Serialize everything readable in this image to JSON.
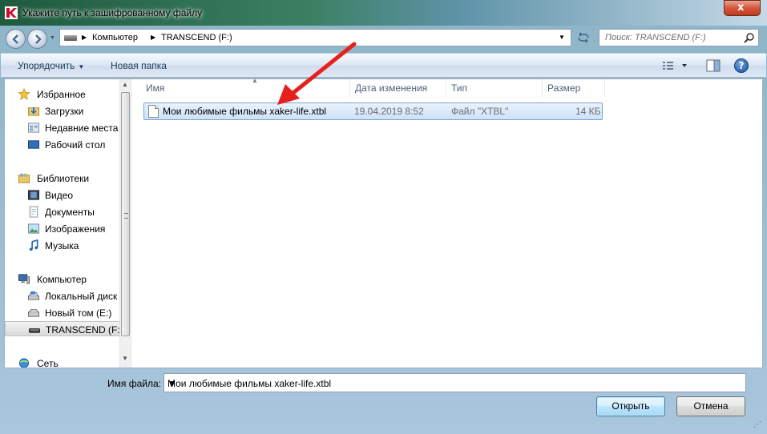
{
  "window": {
    "title": "Укажите путь к зашифрованному файлу",
    "close_label": "x"
  },
  "address": {
    "crumbs": [
      "Компьютер",
      "TRANSCEND (F:)"
    ],
    "search_placeholder": "Поиск: TRANSCEND (F:)"
  },
  "toolbar": {
    "organize": "Упорядочить",
    "new_folder": "Новая папка",
    "help": "?"
  },
  "nav": {
    "favorites": {
      "label": "Избранное",
      "icon": "star-icon"
    },
    "favorites_items": [
      {
        "label": "Загрузки",
        "icon": "downloads-folder-icon"
      },
      {
        "label": "Недавние места",
        "icon": "recent-places-icon"
      },
      {
        "label": "Рабочий стол",
        "icon": "desktop-icon"
      }
    ],
    "libraries": {
      "label": "Библиотеки",
      "icon": "libraries-icon"
    },
    "libraries_items": [
      {
        "label": "Видео",
        "icon": "video-icon"
      },
      {
        "label": "Документы",
        "icon": "documents-icon"
      },
      {
        "label": "Изображения",
        "icon": "pictures-icon"
      },
      {
        "label": "Музыка",
        "icon": "music-icon"
      }
    ],
    "computer": {
      "label": "Компьютер",
      "icon": "computer-icon"
    },
    "computer_items": [
      {
        "label": "Локальный диск",
        "icon": "local-disk-icon"
      },
      {
        "label": "Новый том (E:)",
        "icon": "drive-icon"
      },
      {
        "label": "TRANSCEND (F:)",
        "icon": "usb-drive-icon",
        "selected": true
      }
    ],
    "network": {
      "label": "Сеть",
      "icon": "network-icon"
    }
  },
  "columns": [
    "Имя",
    "Дата изменения",
    "Тип",
    "Размер"
  ],
  "files": [
    {
      "name": "Мои любимые фильмы xaker-life.xtbl",
      "date": "19.04.2019 8:52",
      "type": "Файл \"XTBL\"",
      "size": "14 КБ",
      "selected": true
    }
  ],
  "footer": {
    "filename_label": "Имя файла:",
    "filename_value": "Мои любимые фильмы xaker-life.xtbl",
    "open_button": "Открыть",
    "cancel_button": "Отмена"
  },
  "colors": {
    "annotation_arrow": "#e8201c",
    "selection": "#cde2f8"
  }
}
